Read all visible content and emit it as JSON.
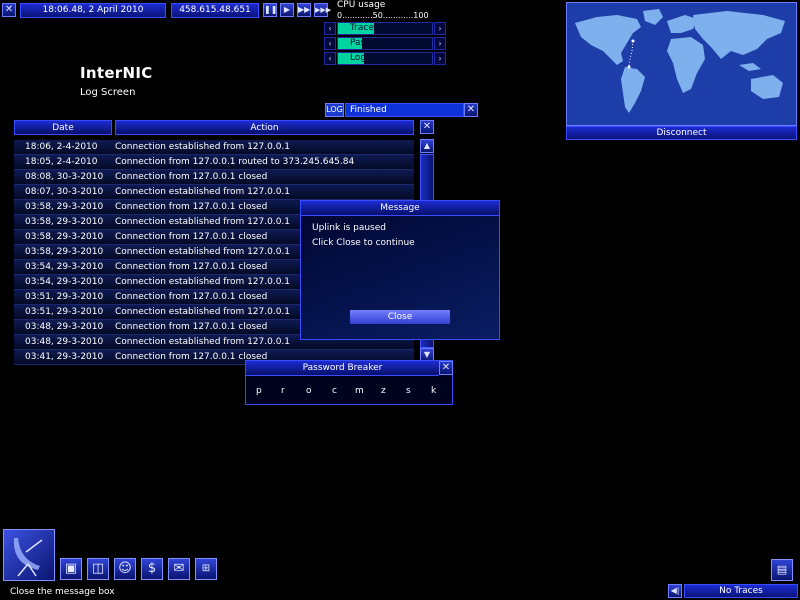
{
  "topbar": {
    "datetime": "18:06.48, 2 April 2010",
    "ip": "458.615.48.651",
    "controls": [
      "pause",
      "play",
      "fast",
      "fastest"
    ]
  },
  "cpu": {
    "title": "CPU usage",
    "scale": "0............50............100",
    "tasks": [
      {
        "label": "Trace_Tracker",
        "fill": 0.38
      },
      {
        "label": "Password_Breaker",
        "fill": 0.25
      },
      {
        "label": "Log_Deleter",
        "fill": 0.28
      }
    ]
  },
  "server": {
    "name": "InterNIC",
    "screen": "Log Screen"
  },
  "log_progress": {
    "badge": "LOG",
    "status": "Finished"
  },
  "log_table": {
    "headers": [
      "Date",
      "Action"
    ],
    "rows": [
      [
        "18:06, 2-4-2010",
        "Connection established from 127.0.0.1"
      ],
      [
        "18:05, 2-4-2010",
        "Connection from 127.0.0.1 routed to 373.245.645.84"
      ],
      [
        "08:08, 30-3-2010",
        "Connection from 127.0.0.1 closed"
      ],
      [
        "08:07, 30-3-2010",
        "Connection established from 127.0.0.1"
      ],
      [
        "03:58, 29-3-2010",
        "Connection from 127.0.0.1 closed"
      ],
      [
        "03:58, 29-3-2010",
        "Connection established from 127.0.0.1"
      ],
      [
        "03:58, 29-3-2010",
        "Connection from 127.0.0.1 closed"
      ],
      [
        "03:58, 29-3-2010",
        "Connection established from 127.0.0.1"
      ],
      [
        "03:54, 29-3-2010",
        "Connection from 127.0.0.1 closed"
      ],
      [
        "03:54, 29-3-2010",
        "Connection established from 127.0.0.1"
      ],
      [
        "03:51, 29-3-2010",
        "Connection from 127.0.0.1 closed"
      ],
      [
        "03:51, 29-3-2010",
        "Connection established from 127.0.0.1"
      ],
      [
        "03:48, 29-3-2010",
        "Connection from 127.0.0.1 closed"
      ],
      [
        "03:48, 29-3-2010",
        "Connection established from 127.0.0.1"
      ],
      [
        "03:41, 29-3-2010",
        "Connection from 127.0.0.1 closed"
      ]
    ]
  },
  "message": {
    "title": "Message",
    "line1": "Uplink is paused",
    "line2": "Click Close to continue",
    "button": "Close"
  },
  "password_breaker": {
    "title": "Password Breaker",
    "chars": [
      "p",
      "r",
      "o",
      "c",
      "m",
      "z",
      "s",
      "k"
    ]
  },
  "map": {
    "button": "Disconnect"
  },
  "status_bar": {
    "hint": "Close the message box",
    "traces": "No Traces"
  },
  "colors": {
    "accent": "#1c2bd0",
    "task_fill": "#00d3a0",
    "ocean": "#1d3ea8",
    "land": "#7fb0ee"
  }
}
